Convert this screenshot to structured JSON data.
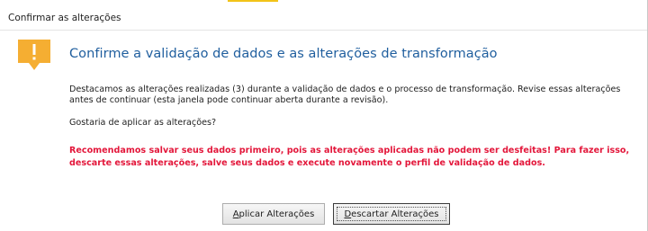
{
  "window": {
    "title": "Confirmar as alterações"
  },
  "dialog": {
    "heading": "Confirme a validação de dados e as alterações de transformação",
    "description": "Destacamos as alterações realizadas (3) durante a validação de dados e o processo de transformação. Revise essas alterações antes de continuar (esta janela pode continuar aberta durante a revisão).",
    "question": "Gostaria de aplicar as alterações?",
    "warning": "Recomendamos salvar seus dados primeiro, pois as alterações aplicadas não podem ser desfeitas! Para fazer isso, descarte essas alterações, salve seus dados e execute novamente o perfil de validação de dados."
  },
  "buttons": {
    "apply": {
      "mnemonic": "A",
      "rest": "plicar Alterações"
    },
    "discard": {
      "mnemonic": "D",
      "rest": "escartar Alterações"
    }
  },
  "colors": {
    "heading": "#1f5e9e",
    "warning_text": "#e3163a",
    "warning_icon": "#f5ae32"
  },
  "icons": {
    "banner": "warning-icon"
  }
}
